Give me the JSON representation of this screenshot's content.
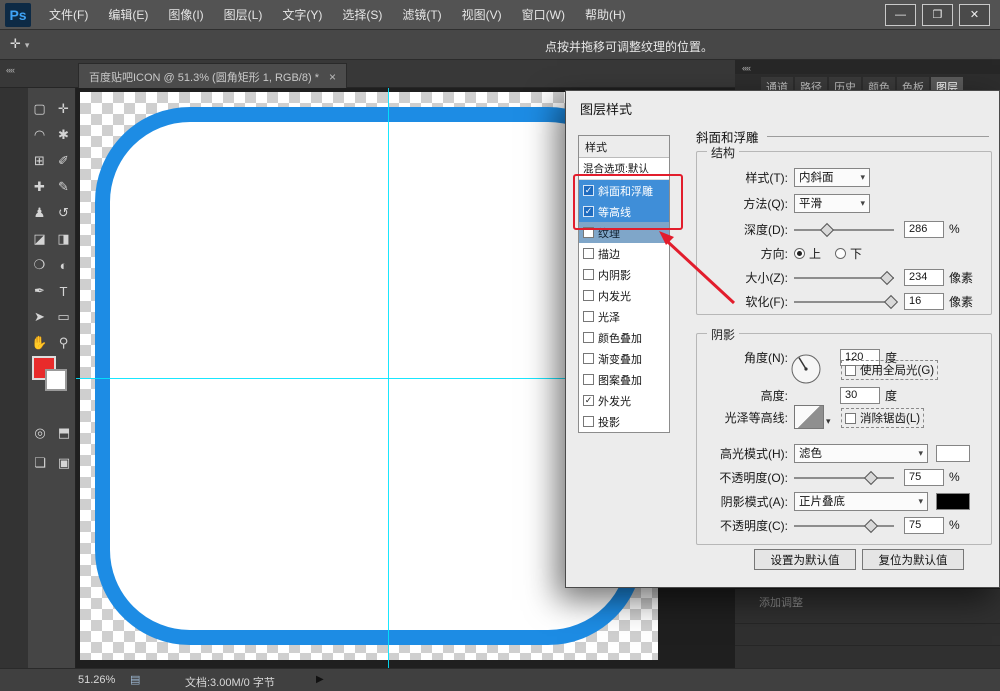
{
  "titlebar": {
    "logo": "Ps",
    "menus": [
      "文件(F)",
      "编辑(E)",
      "图像(I)",
      "图层(L)",
      "文字(Y)",
      "选择(S)",
      "滤镜(T)",
      "视图(V)",
      "窗口(W)",
      "帮助(H)"
    ],
    "window": {
      "minimize": "—",
      "restore": "❐",
      "close": "✕"
    }
  },
  "options_bar": {
    "tool_glyph": "✛",
    "caret": "▾",
    "hint": "点按并拖移可调整纹理的位置。"
  },
  "tab_strip": {
    "collapse": "««",
    "document_tab": "百度贴吧ICON @ 51.3% (圆角矩形 1, RGB/8) *",
    "close": "×"
  },
  "toolbar": {
    "tools": [
      {
        "name": "rectangular-marquee",
        "glyph": "▢"
      },
      {
        "name": "move",
        "glyph": "✛"
      },
      {
        "name": "lasso",
        "glyph": "◠"
      },
      {
        "name": "quick-selection",
        "glyph": "✱"
      },
      {
        "name": "crop",
        "glyph": "⊞"
      },
      {
        "name": "eyedropper",
        "glyph": "✐"
      },
      {
        "name": "healing-brush",
        "glyph": "✚"
      },
      {
        "name": "brush",
        "glyph": "✎"
      },
      {
        "name": "clone-stamp",
        "glyph": "♟"
      },
      {
        "name": "history-brush",
        "glyph": "↺"
      },
      {
        "name": "eraser",
        "glyph": "◪"
      },
      {
        "name": "gradient",
        "glyph": "◨"
      },
      {
        "name": "blur",
        "glyph": "❍"
      },
      {
        "name": "dodge",
        "glyph": "◐"
      },
      {
        "name": "pen",
        "glyph": "✒"
      },
      {
        "name": "type",
        "glyph": "T"
      },
      {
        "name": "path-selection",
        "glyph": "➤"
      },
      {
        "name": "shape",
        "glyph": "▭"
      },
      {
        "name": "hand",
        "glyph": "✋"
      },
      {
        "name": "zoom",
        "glyph": "⚲"
      }
    ],
    "extras": [
      {
        "name": "edit-quick-mask",
        "glyph": "◎"
      },
      {
        "name": "screen-mode",
        "glyph": "⬒"
      },
      {
        "name": "mask",
        "glyph": "❏"
      },
      {
        "name": "panel-toggle",
        "glyph": "▣"
      }
    ],
    "foreground_color": "#e82b2b",
    "background_color": "#ffffff"
  },
  "canvas": {
    "shape_border_color": "#1d8ce4",
    "guide_color": "#00e4ff",
    "checker_color": "#cfcfcf"
  },
  "right_dock": {
    "collapse": "««",
    "panel_tabs": [
      "通道",
      "路径",
      "历史",
      "颜色",
      "色板",
      "图层"
    ],
    "active_panel_tab": "图层",
    "adjustments_label": "添加调整"
  },
  "dialog": {
    "title": "图层样式",
    "styles_header": "样式",
    "blending_row": "混合选项:默认",
    "style_items": [
      {
        "label": "斜面和浮雕",
        "mark": "✓",
        "sel": "1"
      },
      {
        "label": "等高线",
        "mark": "✓",
        "sel": "1"
      },
      {
        "label": "纹理",
        "mark": "",
        "sel": "2"
      },
      {
        "label": "描边",
        "mark": "",
        "sel": "0"
      },
      {
        "label": "内阴影",
        "mark": "",
        "sel": "0"
      },
      {
        "label": "内发光",
        "mark": "",
        "sel": "0"
      },
      {
        "label": "光泽",
        "mark": "",
        "sel": "0"
      },
      {
        "label": "颜色叠加",
        "mark": "",
        "sel": "0"
      },
      {
        "label": "渐变叠加",
        "mark": "",
        "sel": "0"
      },
      {
        "label": "图案叠加",
        "mark": "",
        "sel": "0"
      },
      {
        "label": "外发光",
        "mark": "✓",
        "sel": "0"
      },
      {
        "label": "投影",
        "mark": "",
        "sel": "0"
      }
    ],
    "panel": {
      "title": "斜面和浮雕",
      "group_structure": "结构",
      "group_shading": "阴影",
      "caret": "▾",
      "style_label": "样式(T):",
      "style_value": "内斜面",
      "technique_label": "方法(Q):",
      "technique_value": "平滑",
      "depth_label": "深度(D):",
      "depth_value": "286",
      "depth_unit": "%",
      "direction_label": "方向:",
      "direction_up": "上",
      "direction_down": "下",
      "size_label": "大小(Z):",
      "size_value": "234",
      "size_unit": "像素",
      "soften_label": "软化(F):",
      "soften_value": "16",
      "soften_unit": "像素",
      "angle_label": "角度(N):",
      "angle_value": "120",
      "angle_unit": "度",
      "global_light_label": "使用全局光(G)",
      "altitude_label": "高度:",
      "altitude_value": "30",
      "altitude_unit": "度",
      "gloss_label": "光泽等高线:",
      "antialias_label": "消除锯齿(L)",
      "highlight_label": "高光模式(H):",
      "highlight_value": "滤色",
      "opacity_high_label": "不透明度(O):",
      "opacity_high_value": "75",
      "opacity_high_unit": "%",
      "shadow_label": "阴影模式(A):",
      "shadow_value": "正片叠底",
      "opacity_shadow_label": "不透明度(C):",
      "opacity_shadow_value": "75",
      "opacity_shadow_unit": "%",
      "set_default": "设置为默认值",
      "reset_default": "复位为默认值"
    }
  },
  "statusbar": {
    "zoom": "51.26%",
    "doc_icon": "▤",
    "doc_info": "文档:3.00M/0 字节",
    "expander": "▶"
  },
  "annotation": {
    "color": "#e21d2c"
  }
}
